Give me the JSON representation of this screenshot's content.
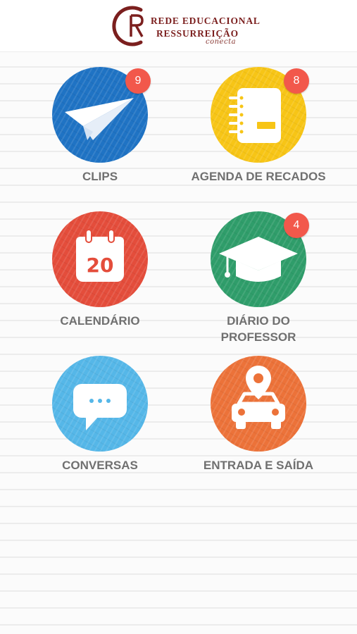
{
  "header": {
    "logo_line1": "REDE EDUCACIONAL",
    "logo_line2": "RESSURREIÇÃO",
    "logo_tagline": "conecta"
  },
  "menu": [
    {
      "label": "CLIPS",
      "badge": "9",
      "icon": "paper-plane-icon",
      "color": "#1f73c4"
    },
    {
      "label": "AGENDA DE RECADOS",
      "badge": "8",
      "icon": "notebook-icon",
      "color": "#f7c516"
    },
    {
      "label": "CALENDÁRIO",
      "badge": "",
      "icon": "calendar-icon",
      "color": "#e44d3b",
      "icon_text": "20"
    },
    {
      "label_line1": "DIÁRIO DO",
      "label_line2": "PROFESSOR",
      "badge": "4",
      "icon": "graduation-cap-icon",
      "color": "#2f9d6a"
    },
    {
      "label": "CONVERSAS",
      "badge": "",
      "icon": "chat-bubble-icon",
      "color": "#55b7e8"
    },
    {
      "label": "ENTRADA E SAÍDA",
      "badge": "",
      "icon": "car-location-icon",
      "color": "#ec7239"
    }
  ],
  "badge_color": "#f2584b"
}
